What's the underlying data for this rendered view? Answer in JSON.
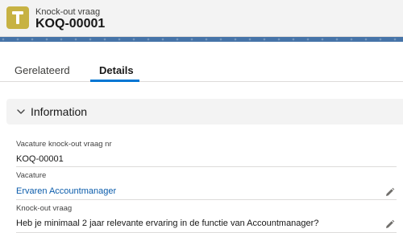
{
  "header": {
    "object_type": "Knock-out vraag",
    "record_name": "KOQ-00001",
    "icon": "question-tag-icon",
    "icon_color": "#c7b243"
  },
  "tabs": [
    {
      "label": "Gerelateerd",
      "active": false
    },
    {
      "label": "Details",
      "active": true
    }
  ],
  "section": {
    "title": "Information",
    "expanded": true
  },
  "fields": [
    {
      "label": "Vacature knock-out vraag nr",
      "value": "KOQ-00001",
      "editable": false
    },
    {
      "label": "Vacature",
      "value": "Ervaren Accountmanager",
      "is_link": true,
      "editable": true
    },
    {
      "label": "Knock-out vraag",
      "value": "Heb je minimaal 2 jaar relevante ervaring in de functie van Accountmanager?",
      "editable": true
    }
  ],
  "colors": {
    "accent": "#0176d3",
    "link": "#0b5cab",
    "band": "#4674a8"
  }
}
